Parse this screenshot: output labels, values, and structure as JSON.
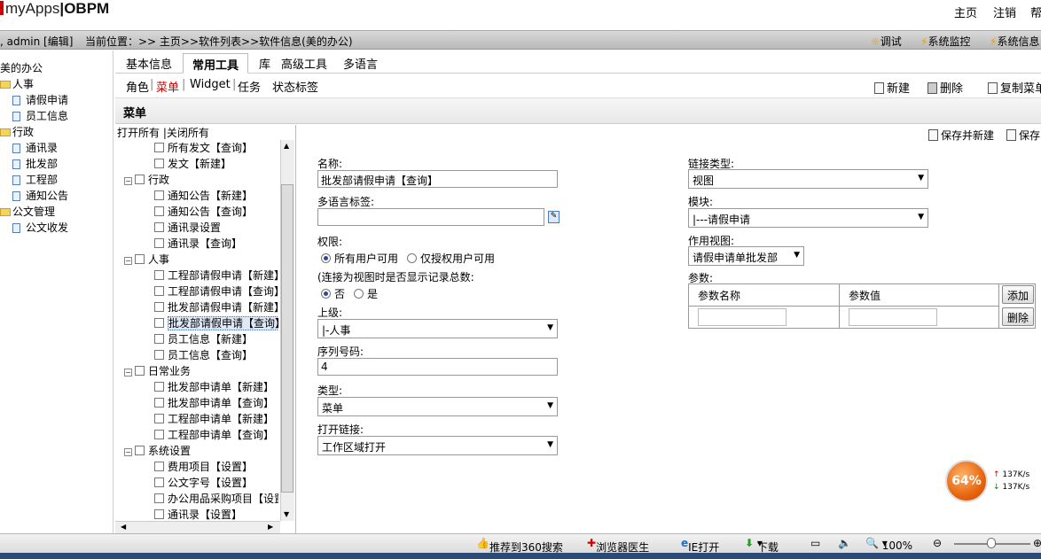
{
  "header": {
    "app_name": "myApps",
    "product": "OBPM",
    "links": [
      "主页",
      "注销",
      "帮"
    ]
  },
  "infobar": {
    "user": ", admin [编辑]",
    "location": "当前位置：>> 主页>>软件列表>>软件信息(美的办公)",
    "tools": [
      "调试",
      "系统监控",
      "系统信息"
    ]
  },
  "left_tree": {
    "items": [
      "美的办公",
      "人事",
      "请假申请",
      "员工信息",
      "行政",
      "通讯录",
      "批发部",
      "工程部",
      "通知公告",
      "公文管理",
      "公文收发"
    ]
  },
  "tabs": [
    "基本信息",
    "常用工具",
    "库",
    "高级工具",
    "多语言"
  ],
  "active_tab": "常用工具",
  "subtabs": {
    "items": [
      "角色",
      "菜单",
      "Widget",
      "任务",
      "状态标签"
    ],
    "active": "菜单",
    "separators": [
      "|",
      "|",
      "|"
    ]
  },
  "toolbar": {
    "new": "新建",
    "delete": "删除",
    "copy": "复制菜单"
  },
  "panel": {
    "title": "菜单",
    "open_all": "打开所有",
    "close_all": "关闭所有",
    "save_new": "保存并新建",
    "save": "保存"
  },
  "menu_tree": [
    "所有发文【查询】",
    "发文【新建】",
    "行政",
    "通知公告【新建】",
    "通知公告【查询】",
    "通讯录设置",
    "通讯录【查询】",
    "人事",
    "工程部请假申请【新建】",
    "工程部请假申请【查询】",
    "批发部请假申请【新建】",
    "批发部请假申请【查询】",
    "员工信息【新建】",
    "员工信息【查询】",
    "日常业务",
    "批发部申请单【新建】",
    "批发部申请单【查询】",
    "工程部申请单【新建】",
    "工程部申请单【查询】",
    "系统设置",
    "费用项目【设置】",
    "公文字号【设置】",
    "办公用品采购项目【设置】",
    "通讯录【设置】"
  ],
  "form": {
    "name_label": "名称:",
    "name_value": "批发部请假申请【查询】",
    "i18n_label": "多语言标签:",
    "i18n_value": "",
    "perm_label": "权限:",
    "perm_all": "所有用户可用",
    "perm_auth": "仅授权用户可用",
    "count_label": "(连接为视图时是否显示记录总数:",
    "count_no": "否",
    "count_yes": "是",
    "parent_label": "上级:",
    "parent_value": "|-人事",
    "order_label": "序列号码:",
    "order_value": "4",
    "type_label": "类型:",
    "type_value": "菜单",
    "open_label": "打开链接:",
    "open_value": "工作区域打开",
    "link_type_label": "链接类型:",
    "link_type_value": "视图",
    "module_label": "模块:",
    "module_value": "|---请假申请",
    "view_label": "作用视图:",
    "view_value": "请假申请单批发部",
    "param_label": "参数:",
    "param_name_header": "参数名称",
    "param_value_header": "参数值",
    "add_button": "添加",
    "delete_button": "删除"
  },
  "speed": {
    "percent": "64%",
    "up": "137K/s",
    "down": "137K/s"
  },
  "status": {
    "items": [
      "推荐到360搜索",
      "浏览器医生",
      "IE打开",
      "下载",
      "100%"
    ]
  }
}
